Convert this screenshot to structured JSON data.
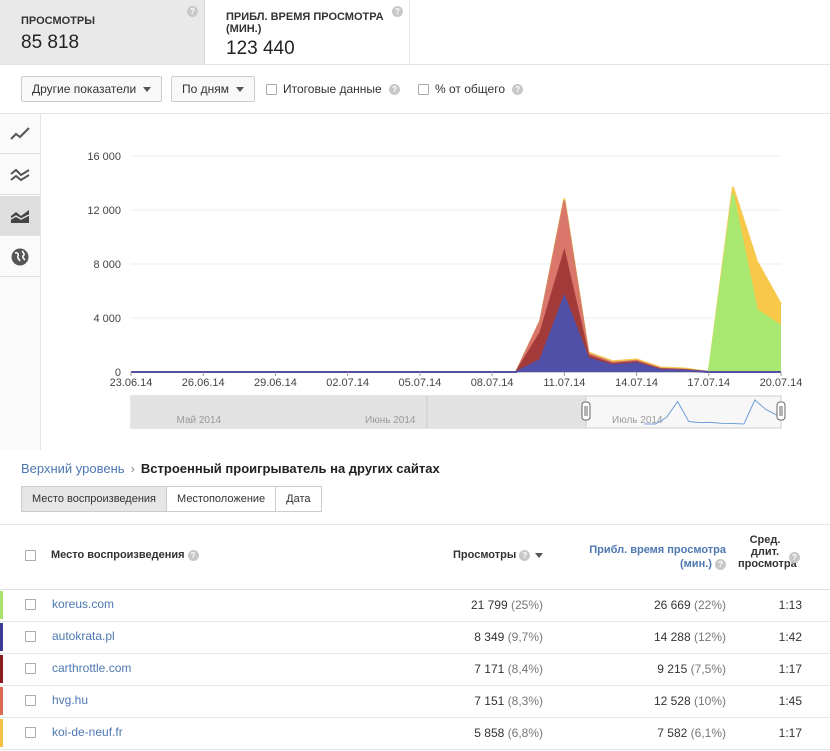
{
  "metrics": [
    {
      "label": "ПРОСМОТРЫ",
      "value": "85 818"
    },
    {
      "label": "ПРИБЛ. ВРЕМЯ ПРОСМОТРА (МИН.)",
      "value": "123 440"
    }
  ],
  "toolbar": {
    "other_metrics": "Другие показатели",
    "by_day": "По дням",
    "totals": "Итоговые данные",
    "percent_total": "% от общего"
  },
  "sidebar": {
    "icons": [
      "line-chart-icon",
      "multi-line-icon",
      "stacked-area-icon",
      "globe-icon"
    ],
    "active": 2
  },
  "breadcrumb": {
    "top": "Верхний уровень",
    "current": "Встроенный проигрыватель на других сайтах"
  },
  "tabs": [
    "Место воспроизведения",
    "Местоположение",
    "Дата"
  ],
  "table": {
    "headers": {
      "place": "Место воспроизведения",
      "views": "Просмотры",
      "time": "Прибл. время просмотра (мин.)",
      "avg": "Сред. длит. просмотра"
    },
    "rows": [
      {
        "site": "koreus.com",
        "views": "21 799",
        "views_pct": "(25%)",
        "time": "26 669",
        "time_pct": "(22%)",
        "avg": "1:13",
        "color": "#a9e16f"
      },
      {
        "site": "autokrata.pl",
        "views": "8 349",
        "views_pct": "(9,7%)",
        "time": "14 288",
        "time_pct": "(12%)",
        "avg": "1:42",
        "color": "#3b3b94"
      },
      {
        "site": "carthrottle.com",
        "views": "7 171",
        "views_pct": "(8,4%)",
        "time": "9 215",
        "time_pct": "(7,5%)",
        "avg": "1:17",
        "color": "#8b1c1c"
      },
      {
        "site": "hvg.hu",
        "views": "7 151",
        "views_pct": "(8,3%)",
        "time": "12 528",
        "time_pct": "(10%)",
        "avg": "1:45",
        "color": "#d9694f"
      },
      {
        "site": "koi-de-neuf.fr",
        "views": "5 858",
        "views_pct": "(6,8%)",
        "time": "7 582",
        "time_pct": "(6,1%)",
        "avg": "1:17",
        "color": "#f5c044"
      }
    ]
  },
  "chart_data": {
    "type": "area",
    "stacked": true,
    "x": [
      "23.06.14",
      "24.06.14",
      "25.06.14",
      "26.06.14",
      "27.06.14",
      "28.06.14",
      "29.06.14",
      "30.06.14",
      "01.07.14",
      "02.07.14",
      "03.07.14",
      "04.07.14",
      "05.07.14",
      "06.07.14",
      "07.07.14",
      "08.07.14",
      "09.07.14",
      "10.07.14",
      "11.07.14",
      "12.07.14",
      "13.07.14",
      "14.07.14",
      "15.07.14",
      "16.07.14",
      "17.07.14",
      "18.07.14",
      "19.07.14",
      "20.07.14"
    ],
    "xticks": [
      "23.06.14",
      "26.06.14",
      "29.06.14",
      "02.07.14",
      "05.07.14",
      "08.07.14",
      "11.07.14",
      "14.07.14",
      "17.07.14",
      "20.07.14"
    ],
    "yticks": [
      "0",
      "4 000",
      "8 000",
      "12 000",
      "16 000"
    ],
    "ylim": [
      0,
      16000
    ],
    "series": [
      {
        "name": "autokrata.pl",
        "color": "#5050a8",
        "values": [
          0,
          0,
          0,
          0,
          0,
          0,
          0,
          0,
          0,
          0,
          0,
          0,
          0,
          0,
          0,
          0,
          0,
          900,
          5600,
          1000,
          500,
          650,
          150,
          100,
          0,
          0,
          0,
          0
        ]
      },
      {
        "name": "carthrottle.com",
        "color": "#a33a3a",
        "values": [
          0,
          0,
          0,
          0,
          0,
          0,
          0,
          0,
          0,
          0,
          0,
          0,
          0,
          0,
          0,
          0,
          0,
          2000,
          3300,
          200,
          100,
          100,
          50,
          50,
          0,
          0,
          0,
          0
        ]
      },
      {
        "name": "hvg.hu",
        "color": "#d9776a",
        "values": [
          0,
          0,
          0,
          0,
          0,
          0,
          0,
          0,
          0,
          0,
          0,
          0,
          0,
          0,
          0,
          0,
          0,
          900,
          3800,
          150,
          100,
          80,
          50,
          30,
          0,
          0,
          0,
          0
        ]
      },
      {
        "name": "koreus.com",
        "color": "#a9e870",
        "values": [
          0,
          0,
          0,
          0,
          0,
          0,
          0,
          0,
          0,
          0,
          0,
          0,
          0,
          0,
          0,
          0,
          0,
          0,
          0,
          0,
          0,
          0,
          0,
          0,
          0,
          13200,
          4600,
          3400
        ]
      },
      {
        "name": "koi-de-neuf.fr",
        "color": "#f7c84a",
        "values": [
          0,
          0,
          0,
          0,
          0,
          0,
          0,
          0,
          0,
          0,
          0,
          0,
          0,
          0,
          0,
          0,
          0,
          0,
          150,
          100,
          100,
          100,
          80,
          80,
          0,
          500,
          3600,
          1600
        ]
      }
    ],
    "navigator": {
      "labels": [
        "Май 2014",
        "Июнь 2014",
        "Июль 2014"
      ]
    }
  }
}
